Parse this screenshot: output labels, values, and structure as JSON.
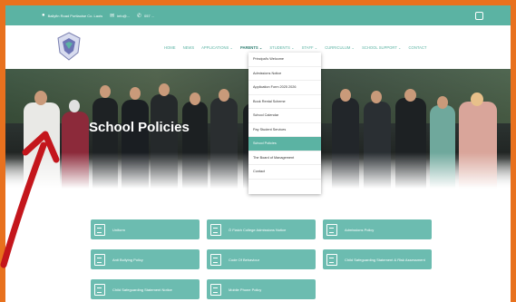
{
  "topbar": {
    "address": "Ballyfin Road Portlaoise Co. Laois",
    "email": "info@...",
    "phone": "057 ..."
  },
  "nav": [
    {
      "label": "HOME"
    },
    {
      "label": "NEWS"
    },
    {
      "label": "APPLICATIONS ⌄"
    },
    {
      "label": "PARENTS ⌄"
    },
    {
      "label": "STUDENTS ⌄"
    },
    {
      "label": "STAFF ⌄"
    },
    {
      "label": "CURRICULUM ⌄"
    },
    {
      "label": "SCHOOL SUPPORT ⌄"
    },
    {
      "label": "CONTACT"
    }
  ],
  "hero": {
    "title": "School Policies"
  },
  "dropdown": [
    {
      "label": "Principal's Welcome"
    },
    {
      "label": "Admissions Notice"
    },
    {
      "label": "Application Form 2025 2026"
    },
    {
      "label": "Book Rental Scheme"
    },
    {
      "label": "School Calendar"
    },
    {
      "label": "Pay Student Services"
    },
    {
      "label": "School Policies"
    },
    {
      "label": "The Board of Management"
    },
    {
      "label": "Contact"
    }
  ],
  "policies": [
    {
      "label": "Uniform"
    },
    {
      "label": "Ó Fiaich College Admissions Notice"
    },
    {
      "label": "Admissions Policy"
    },
    {
      "label": "Anti Bullying Policy"
    },
    {
      "label": "Code Of Behaviour"
    },
    {
      "label": "Child Safeguarding Statement & Risk Assessment"
    },
    {
      "label": "Child Safeguarding Statement Notice"
    },
    {
      "label": "Mobile Phone Policy"
    }
  ],
  "colors": {
    "accent": "#5bb3a3",
    "frame": "#e8711e",
    "arrow": "#c4161c"
  }
}
